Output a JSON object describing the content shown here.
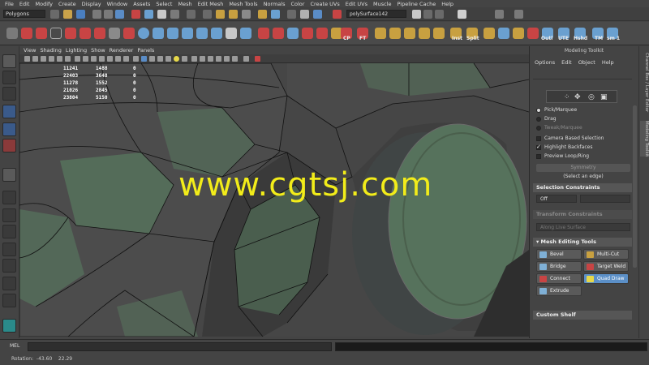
{
  "menubar": [
    "File",
    "Edit",
    "Modify",
    "Create",
    "Display",
    "Window",
    "Assets",
    "Select",
    "Mesh",
    "Edit Mesh",
    "Mesh Tools",
    "Normals",
    "Color",
    "Create UVs",
    "Edit UVs",
    "Muscle",
    "Pipeline Cache",
    "Help"
  ],
  "status": {
    "mode": "Polygons",
    "object_field": "polySurface142"
  },
  "shelf_labels": {
    "cp": "CP",
    "ft": "FT",
    "inst": "Inst",
    "split": "Split",
    "outl": "Outl",
    "ute": "UTE",
    "hshd": "Hshd",
    "tm": "TM",
    "sm": "sm 1"
  },
  "viewport_menu": [
    "View",
    "Shading",
    "Lighting",
    "Show",
    "Renderer",
    "Panels"
  ],
  "hud_stats": [
    [
      "11241",
      "1488",
      "0"
    ],
    [
      "22403",
      "3648",
      "0"
    ],
    [
      "11278",
      "1552",
      "0"
    ],
    [
      "21026",
      "2845",
      "0"
    ],
    [
      "23804",
      "5150",
      "0"
    ]
  ],
  "watermark": "www.cgtsj.com",
  "toolkit": {
    "title": "Modeling Toolkit",
    "menu": [
      "Options",
      "Edit",
      "Object",
      "Help"
    ],
    "pick": "Pick/Marquee",
    "drag": "Drag",
    "tweak": "Tweak/Marquee",
    "camera_based": "Camera Based Selection",
    "highlight_backfaces": "Highlight Backfaces",
    "preview_loop": "Preview Loop/Ring",
    "symmetry": "Symmetry",
    "symmetry_hint": "(Select an edge)",
    "sel_constraints": "Selection Constraints",
    "constraint_value": "Off",
    "transform_constraints": "Transform Constraints",
    "transform_value": "Along Live Surface",
    "mesh_editing_tools": "Mesh Editing Tools",
    "tools": {
      "bevel": "Bevel",
      "multicut": "Multi-Cut",
      "bridge": "Bridge",
      "target_weld": "Target Weld",
      "connect": "Connect",
      "quad_draw": "Quad Draw",
      "extrude": "Extrude"
    },
    "custom_shelf": "Custom Shelf"
  },
  "side_tabs": {
    "channel_box": "Channel Box / Layer Editor",
    "toolkit": "Modeling Toolkit"
  },
  "cmdline": {
    "mel": "MEL"
  },
  "helpline": "Rotation:  -43.60    22.29",
  "colors": {
    "accent": "#5b8fc7",
    "watermark": "#f2ec1a",
    "mesh": "#4a4a4a",
    "mesh_green": "#56725c"
  }
}
